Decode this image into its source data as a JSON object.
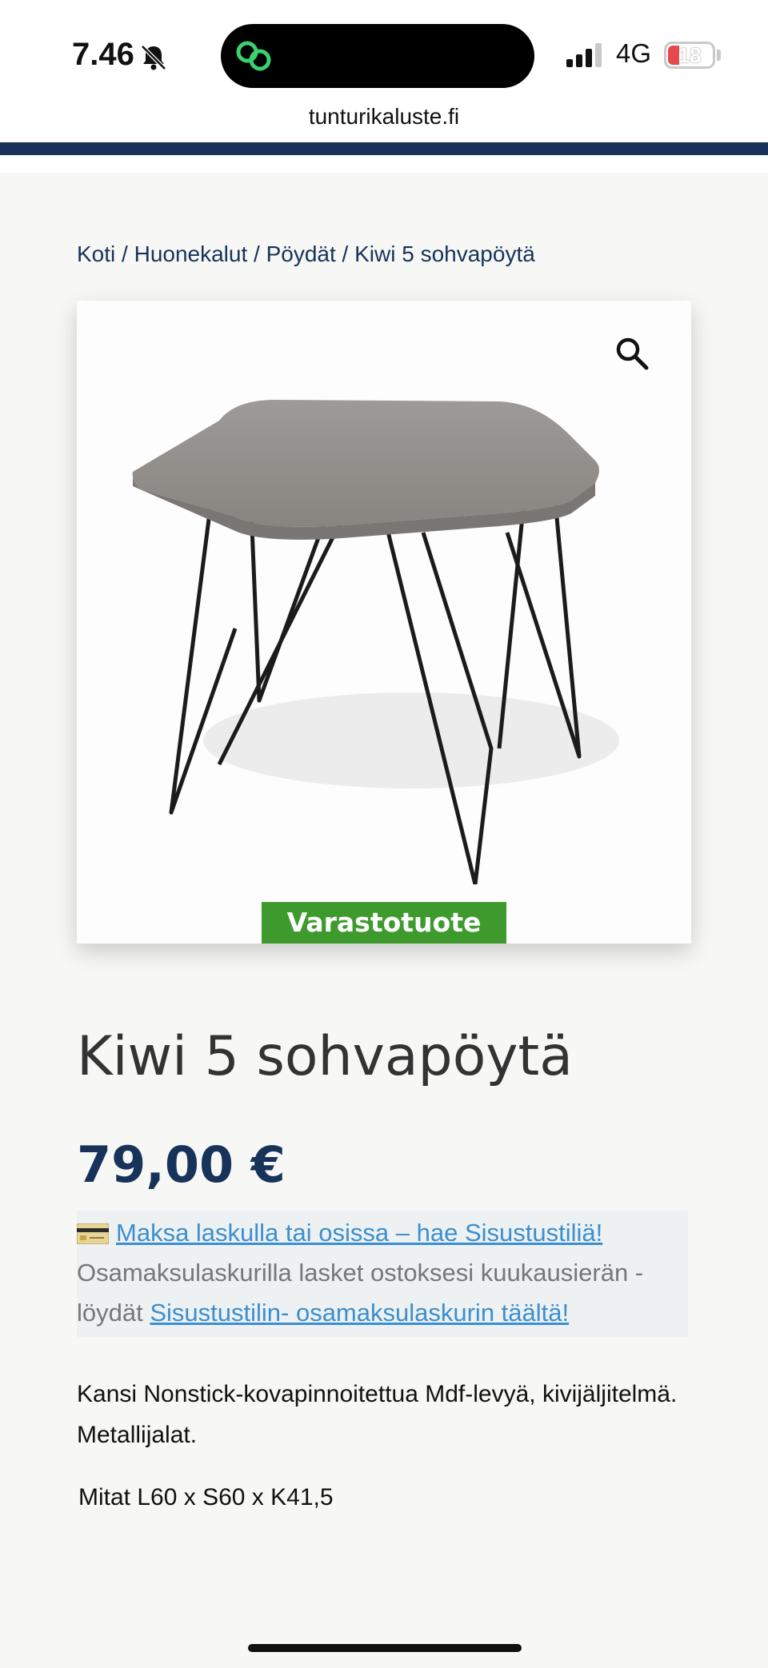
{
  "status_bar": {
    "time": "7.46",
    "network": "4G",
    "battery_level": "18",
    "url": "tunturikaluste.fi"
  },
  "breadcrumb": {
    "items": [
      "Koti",
      "Huonekalut",
      "Pöydät",
      "Kiwi 5 sohvapöytä"
    ],
    "separator": " / "
  },
  "product": {
    "badge": "Varastotuote",
    "title": "Kiwi 5 sohvapöytä",
    "price": "79,00 €",
    "description": "Kansi Nonstick-kovapinnoitettua Mdf-levyä, kivijäljitelmä. Metallijalat.",
    "dimensions_label": "Mitat",
    "dimensions_value": "L60 x S60 x K41,5"
  },
  "finance": {
    "link_text": "Maksa laskulla tai osissa – hae Sisustustiliä!",
    "text_line1": "Osamaksulaskurilla lasket ostoksesi kuukausierän -",
    "text_line2_prefix": "löydät ",
    "link2_text": "Sisustustilin- osamaksulaskurin täältä!"
  },
  "colors": {
    "brand_navy": "#17335a",
    "link_blue": "#3b8fd0",
    "badge_green": "#3f9a2e",
    "finance_bg": "#eef1f2"
  },
  "icons": [
    "bell-muted-icon",
    "link-icon",
    "signal-icon",
    "battery-icon",
    "search-zoom-icon",
    "credit-card-icon"
  ]
}
